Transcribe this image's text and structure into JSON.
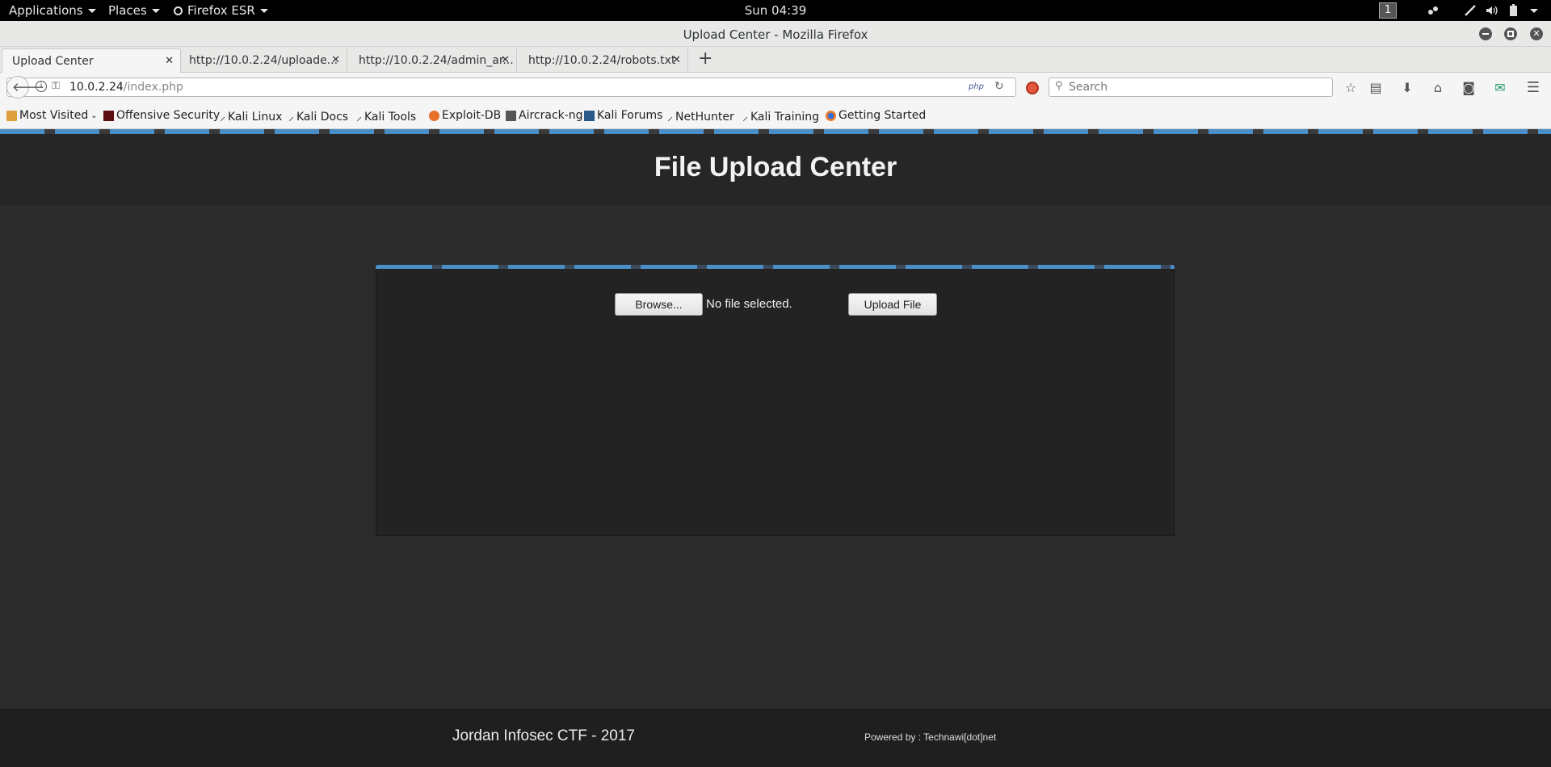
{
  "system_bar": {
    "applications": "Applications",
    "places": "Places",
    "firefox": "Firefox ESR",
    "clock": "Sun 04:39",
    "workspace": "1"
  },
  "window": {
    "title": "Upload Center - Mozilla Firefox"
  },
  "tabs": [
    {
      "label": "Upload Center"
    },
    {
      "label": "http://10.0.2.24/uploade..."
    },
    {
      "label": "http://10.0.2.24/admin_ar..."
    },
    {
      "label": "http://10.0.2.24/robots.txt"
    }
  ],
  "navbar": {
    "url_host": "10.0.2.24",
    "url_path": "/index.php",
    "php_badge": "php",
    "search_placeholder": "Search"
  },
  "bookmarks": [
    {
      "label": "Most Visited",
      "icon": "folder-icon"
    },
    {
      "label": "Offensive Security",
      "icon": "offsec-icon"
    },
    {
      "label": "Kali Linux",
      "icon": "kali-icon"
    },
    {
      "label": "Kali Docs",
      "icon": "kali-icon"
    },
    {
      "label": "Kali Tools",
      "icon": "kali-icon"
    },
    {
      "label": "Exploit-DB",
      "icon": "exploitdb-icon"
    },
    {
      "label": "Aircrack-ng",
      "icon": "aircrack-icon"
    },
    {
      "label": "Kali Forums",
      "icon": "forums-icon"
    },
    {
      "label": "NetHunter",
      "icon": "kali-icon"
    },
    {
      "label": "Kali Training",
      "icon": "kali-icon"
    },
    {
      "label": "Getting Started",
      "icon": "firefox-icon"
    }
  ],
  "page": {
    "heading": "File Upload Center",
    "browse_label": "Browse...",
    "file_status": "No file selected.",
    "upload_label": "Upload File",
    "footer_left": "Jordan Infosec CTF - 2017",
    "footer_right": "Powered by : Technawi[dot]net"
  },
  "colors": {
    "accent": "#4a8fc8",
    "page_bg": "#2b2b2b",
    "panel_bg": "#232323"
  }
}
